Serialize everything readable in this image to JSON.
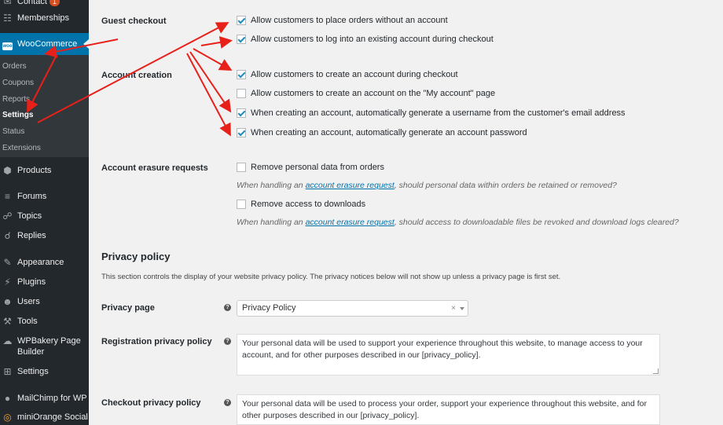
{
  "sidebar": {
    "contact_label": "Contact",
    "contact_badge": "1",
    "memberships_label": "Memberships",
    "woocommerce_label": "WooCommerce",
    "woo_logo_text": "woo",
    "submenu": [
      "Orders",
      "Coupons",
      "Reports",
      "Settings",
      "Status",
      "Extensions"
    ],
    "products_label": "Products",
    "forums_label": "Forums",
    "topics_label": "Topics",
    "replies_label": "Replies",
    "appearance_label": "Appearance",
    "plugins_label": "Plugins",
    "users_label": "Users",
    "tools_label": "Tools",
    "wpbakery_label": "WPBakery Page Builder",
    "settings_label": "Settings",
    "mailchimp_label": "MailChimp for WP",
    "miniorange_label": "miniOrange Social"
  },
  "guest_checkout": {
    "label": "Guest checkout",
    "options": [
      {
        "text": "Allow customers to place orders without an account",
        "checked": true
      },
      {
        "text": "Allow customers to log into an existing account during checkout",
        "checked": true
      }
    ]
  },
  "account_creation": {
    "label": "Account creation",
    "options": [
      {
        "text": "Allow customers to create an account during checkout",
        "checked": true
      },
      {
        "text": "Allow customers to create an account on the \"My account\" page",
        "checked": false
      },
      {
        "text": "When creating an account, automatically generate a username from the customer's email address",
        "checked": true
      },
      {
        "text": "When creating an account, automatically generate an account password",
        "checked": true
      }
    ]
  },
  "erasure": {
    "label": "Account erasure requests",
    "remove_data": "Remove personal data from orders",
    "desc1_pre": "When handling an ",
    "desc1_link": "account erasure request",
    "desc1_post": ", should personal data within orders be retained or removed?",
    "remove_downloads": "Remove access to downloads",
    "desc2_pre": "When handling an ",
    "desc2_link": "account erasure request",
    "desc2_post": ", should access to downloadable files be revoked and download logs cleared?"
  },
  "privacy": {
    "title": "Privacy policy",
    "desc": "This section controls the display of your website privacy policy. The privacy notices below will not show up unless a privacy page is first set.",
    "page_label": "Privacy page",
    "page_value": "Privacy Policy",
    "clear_glyph": "×",
    "registration_label": "Registration privacy policy",
    "registration_text": "Your personal data will be used to support your experience throughout this website, to manage access to your account, and for other purposes described in our [privacy_policy].",
    "checkout_label": "Checkout privacy policy",
    "checkout_text": "Your personal data will be used to process your order, support your experience throughout this website, and for other purposes described in our [privacy_policy]."
  },
  "icons": {
    "help": "?",
    "contact": "contact-icon",
    "memberships": "memberships-icon",
    "products": "products-icon",
    "forums": "forums-icon",
    "topics": "topics-icon",
    "replies": "replies-icon",
    "appearance": "appearance-icon",
    "plugins": "plugins-icon",
    "users": "users-icon",
    "tools": "tools-icon",
    "wpbakery": "wpbakery-icon",
    "settings": "settings-icon",
    "mailchimp": "mailchimp-icon",
    "miniorange": "miniorange-icon"
  },
  "colors": {
    "sidebar_bg": "#23282d",
    "submenu_bg": "#32373c",
    "active_bg": "#0073aa",
    "annotation_red": "#e8201a",
    "link": "#0073aa"
  }
}
